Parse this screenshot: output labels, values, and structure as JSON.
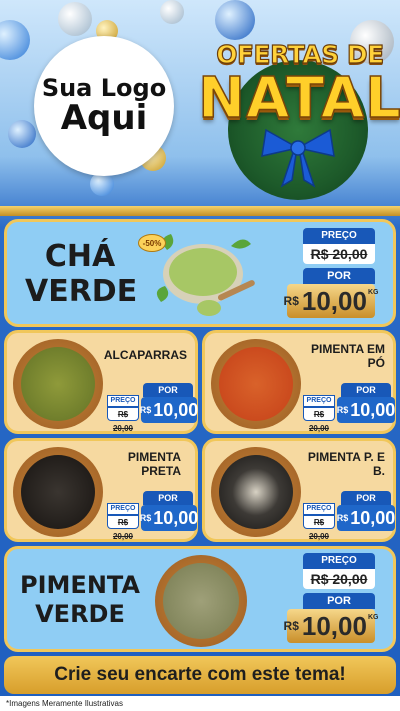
{
  "header": {
    "logo_line1": "Sua Logo",
    "logo_line2": "Aqui",
    "title_line1": "OFERTAS DE",
    "title_line2": "NATAL"
  },
  "featured_top": {
    "name_line1": "CHÁ",
    "name_line2": "VERDE",
    "discount": "-50%",
    "old_label": "PREÇO",
    "old_price": "R$ 20,00",
    "new_label": "POR",
    "currency": "R$",
    "new_price": "10,00",
    "unit": "KG"
  },
  "products": [
    {
      "name": "ALCAPARRAS",
      "old_label": "PREÇO",
      "old_price": "R$ 20,00",
      "new_label": "POR",
      "currency": "R$",
      "new_price": "10,00",
      "color": "#6b7a2a"
    },
    {
      "name": "PIMENTA EM PÓ",
      "old_label": "PREÇO",
      "old_price": "R$ 20,00",
      "new_label": "POR",
      "currency": "R$",
      "new_price": "10,00",
      "color": "#c9471c"
    },
    {
      "name": "PIMENTA PRETA",
      "old_label": "PREÇO",
      "old_price": "R$ 20,00",
      "new_label": "POR",
      "currency": "R$",
      "new_price": "10,00",
      "color": "#2a2623"
    },
    {
      "name": "PIMENTA P. E B.",
      "old_label": "PREÇO",
      "old_price": "R$ 20,00",
      "new_label": "POR",
      "currency": "R$",
      "new_price": "10,00",
      "color": "#3d3a36"
    }
  ],
  "featured_bottom": {
    "name_line1": "PIMENTA",
    "name_line2": "VERDE",
    "old_label": "PREÇO",
    "old_price": "R$ 20,00",
    "new_label": "POR",
    "currency": "R$",
    "new_price": "10,00",
    "unit": "KG"
  },
  "footer": {
    "cta": "Crie seu encarte com este tema!",
    "note": "*Imagens Meramente Ilustrativas"
  },
  "colors": {
    "accent_blue": "#1858b8",
    "gold": "#f1c75a",
    "card_blue": "#8fcdf4",
    "card_tan": "#f6d9a0"
  }
}
